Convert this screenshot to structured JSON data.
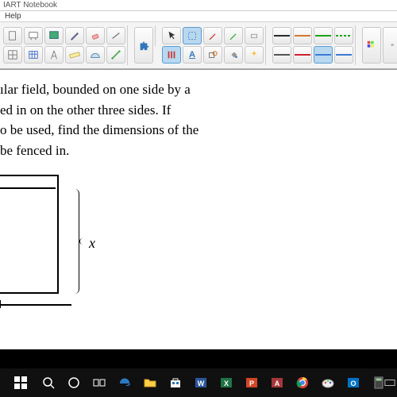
{
  "titlebar": {
    "title": "IART Notebook"
  },
  "menubar": {
    "help": "Help"
  },
  "toolbar": {
    "group1": [
      "doc",
      "slides",
      "screen",
      "pen",
      "eraser",
      "line",
      "grid",
      "clock",
      "compass",
      "ruler",
      "protractor"
    ],
    "group_puzzle": [
      "puzzle"
    ],
    "group_select": [
      "pointer",
      "rect-select",
      "lasso",
      "magic",
      "hand",
      "arrow-text",
      "text",
      "fill",
      "camera",
      "crop"
    ],
    "group_lines": [
      {
        "color": "#2a2a2a"
      },
      {
        "color": "#d07830"
      },
      {
        "color": "#19a319"
      },
      {
        "color": "#19a319",
        "dashed": true
      },
      {
        "color": "#555"
      },
      {
        "color": "#c23"
      },
      {
        "color": "#3a7bd5",
        "selected": true
      },
      {
        "color": "#3a7bd5"
      }
    ],
    "group_color": [
      "palette",
      "label"
    ],
    "group_end": [
      "drop"
    ]
  },
  "problem": {
    "line1": "ılar field, bounded on one side by a",
    "line2": "ed in on the other three sides. If",
    "line3": "o be used, find the dimensions of the",
    "line4": "be fenced in."
  },
  "figure": {
    "xlabel": "x"
  },
  "taskbar": {
    "center_apps": [
      "start",
      "search",
      "cortana",
      "taskview",
      "edge",
      "folder",
      "store",
      "word",
      "excel",
      "powerpoint",
      "access",
      "chrome",
      "paint",
      "outlook",
      "calculator",
      "keyboard"
    ]
  }
}
